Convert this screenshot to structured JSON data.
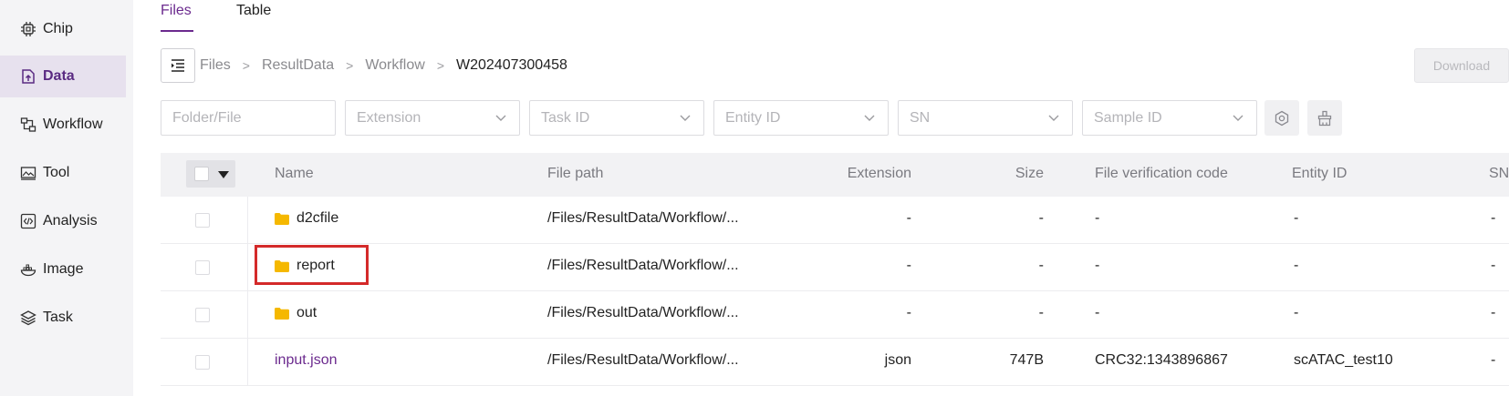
{
  "sidebar": {
    "items": [
      {
        "label": "Chip",
        "icon": "chip-icon"
      },
      {
        "label": "Data",
        "icon": "data-icon"
      },
      {
        "label": "Workflow",
        "icon": "workflow-icon"
      },
      {
        "label": "Tool",
        "icon": "tool-icon"
      },
      {
        "label": "Analysis",
        "icon": "analysis-icon"
      },
      {
        "label": "Image",
        "icon": "image-icon"
      },
      {
        "label": "Task",
        "icon": "task-icon"
      }
    ],
    "active": "Data"
  },
  "tabs": [
    {
      "label": "Files",
      "active": true
    },
    {
      "label": "Table",
      "active": false
    }
  ],
  "breadcrumb": [
    "Files",
    "ResultData",
    "Workflow",
    "W202407300458"
  ],
  "download_label": "Download",
  "filters": {
    "folder_file": "Folder/File",
    "extension": "Extension",
    "task_id": "Task ID",
    "entity_id": "Entity ID",
    "sn": "SN",
    "sample_id": "Sample ID"
  },
  "table": {
    "headers": {
      "name": "Name",
      "file_path": "File path",
      "extension": "Extension",
      "size": "Size",
      "verification": "File verification code",
      "entity_id": "Entity ID",
      "sn": "SN"
    },
    "rows": [
      {
        "name": "d2cfile",
        "type": "folder",
        "path": "/Files/ResultData/Workflow/...",
        "extension": "-",
        "size": "-",
        "code": "-",
        "entity": "-",
        "sn": "-"
      },
      {
        "name": "report",
        "type": "folder",
        "path": "/Files/ResultData/Workflow/...",
        "extension": "-",
        "size": "-",
        "code": "-",
        "entity": "-",
        "sn": "-"
      },
      {
        "name": "out",
        "type": "folder",
        "path": "/Files/ResultData/Workflow/...",
        "extension": "-",
        "size": "-",
        "code": "-",
        "entity": "-",
        "sn": "-"
      },
      {
        "name": "input.json",
        "type": "file",
        "path": "/Files/ResultData/Workflow/...",
        "extension": "json",
        "size": "747B",
        "code": "CRC32:1343896867",
        "entity": "scATAC_test10",
        "sn": "-"
      }
    ]
  },
  "colors": {
    "accent": "#6b2a8e",
    "folder": "#f5b800",
    "highlight": "#d42a2a"
  }
}
